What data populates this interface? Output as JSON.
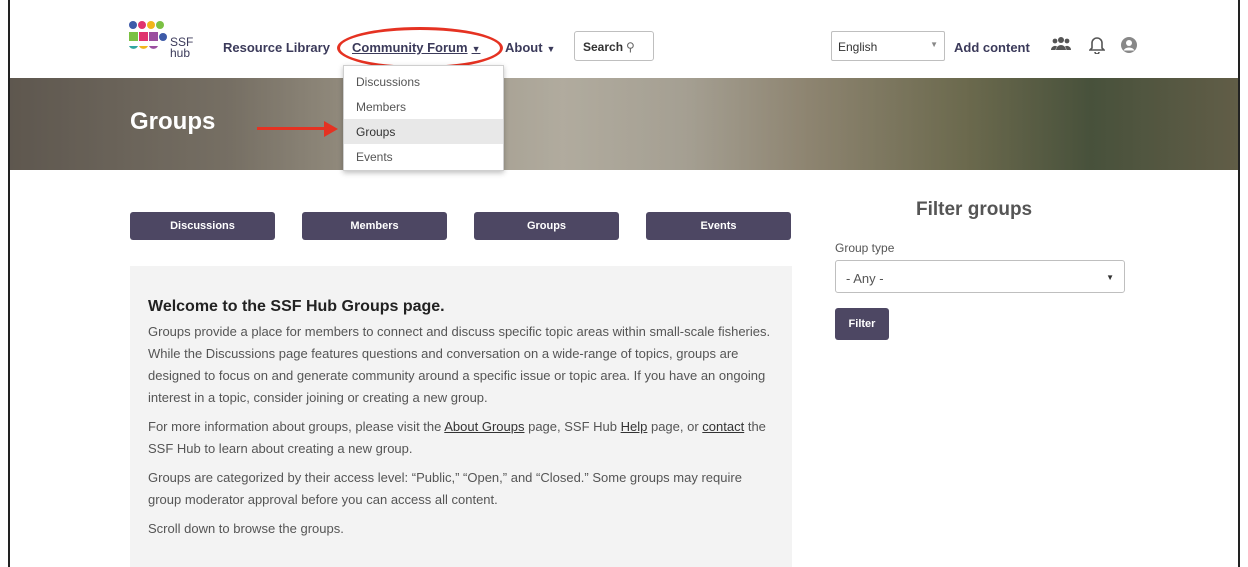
{
  "header": {
    "logo_text_line1": "SSF",
    "logo_text_line2": "hub",
    "nav": {
      "resource_library": "Resource Library",
      "community_forum": "Community Forum",
      "about": "About"
    },
    "search_label": "Search",
    "language": "English",
    "add_content": "Add content",
    "icons": [
      "people-icon",
      "bell-icon",
      "user-icon"
    ]
  },
  "dropdown": {
    "items": [
      "Discussions",
      "Members",
      "Groups",
      "Events"
    ],
    "active": "Groups"
  },
  "banner": {
    "title": "Groups"
  },
  "tabs": [
    "Discussions",
    "Members",
    "Groups",
    "Events"
  ],
  "welcome": {
    "heading": "Welcome to the SSF Hub Groups page.",
    "para1": "Groups provide a place for members to connect and discuss specific topic areas within small-scale fisheries. While the Discussions page features questions and conversation on a wide-range of topics, groups are designed to focus on and generate community around a specific issue or topic area. If you have an ongoing interest in a topic, consider joining or creating a new group.",
    "para2_a": "For more information about groups, please visit the ",
    "para2_link1": "About Groups",
    "para2_b": " page, SSF Hub ",
    "para2_link2": "Help",
    "para2_c": " page, or ",
    "para2_link3": "contact",
    "para2_d": " the SSF Hub to learn about creating a new group.",
    "para3": "Groups are categorized by their access level: “Public,” “Open,” and “Closed.” Some groups may require group moderator approval before you can access all content.",
    "para4": "Scroll down to browse the groups."
  },
  "filter": {
    "title": "Filter groups",
    "group_type_label": "Group type",
    "group_type_value": "- Any -",
    "button": "Filter"
  },
  "colors": {
    "brand_purple": "#4d4763",
    "annotation_red": "#e53222"
  }
}
